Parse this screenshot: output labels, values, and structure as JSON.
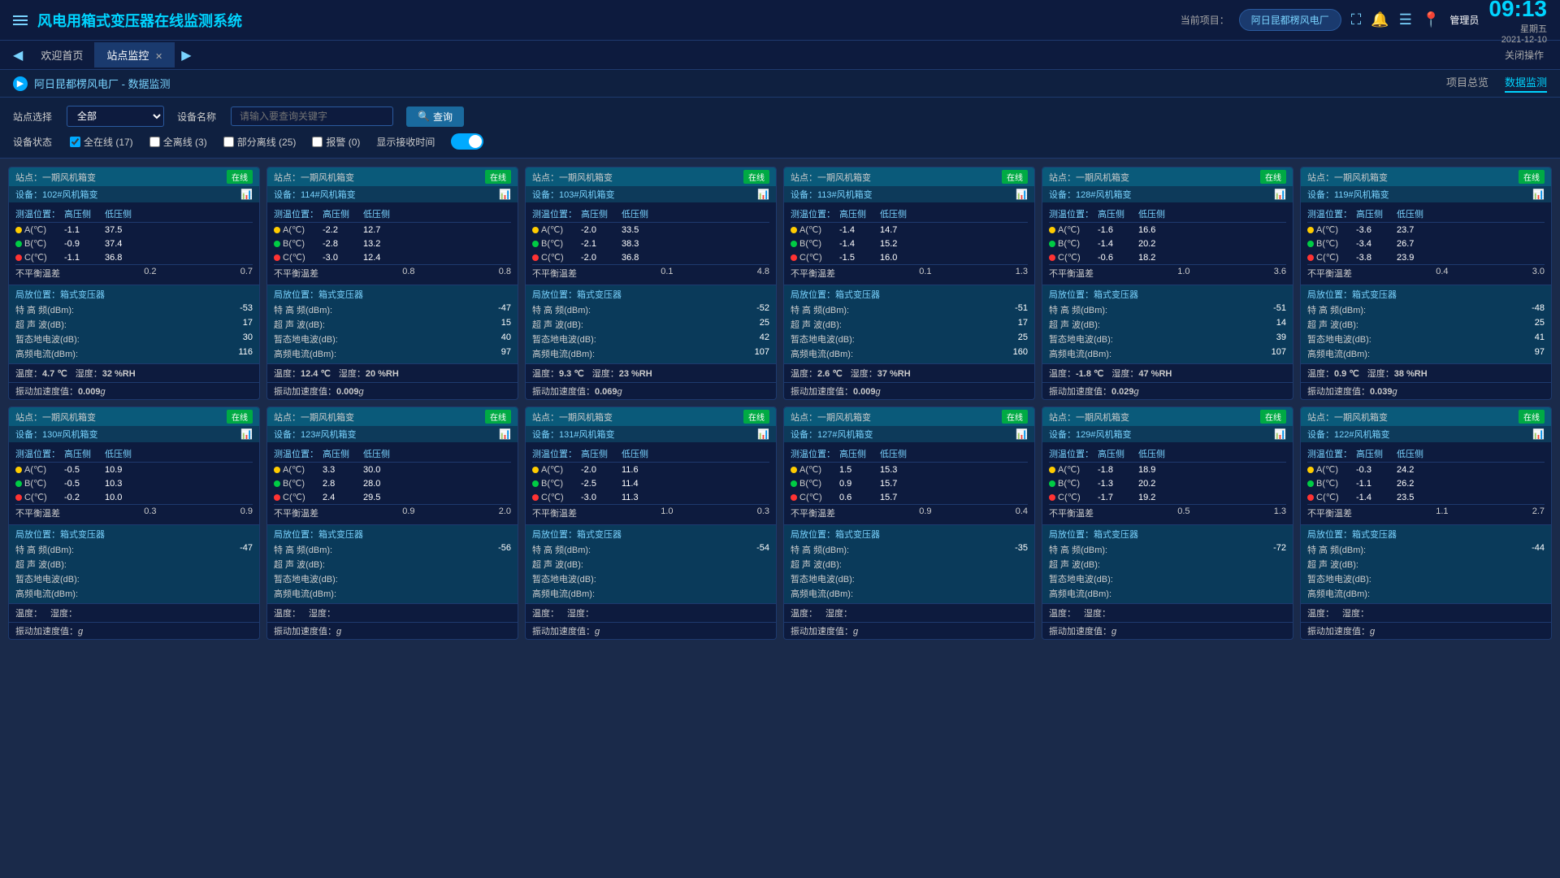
{
  "header": {
    "menu_icon": "☰",
    "title": "风电用箱式变压器在线监测系统",
    "project_label": "当前项目：",
    "project_name": "阿日昆都楞风电厂",
    "time": "09:13",
    "weekday": "星期五",
    "date": "2021-12-10",
    "user": "管理员"
  },
  "tabs": {
    "prev": "◀",
    "next": "▶",
    "items": [
      {
        "label": "欢迎首页",
        "active": false
      },
      {
        "label": "站点监控",
        "active": true,
        "closable": true
      }
    ],
    "close_op": "关闭操作"
  },
  "breadcrumb": {
    "icon": "▶",
    "path": "阿日昆都楞风电厂 - 数据监测",
    "links": [
      {
        "label": "项目总览",
        "active": false
      },
      {
        "label": "数据监测",
        "active": true
      }
    ]
  },
  "filter": {
    "station_label": "站点选择",
    "station_value": "全部",
    "device_label": "设备名称",
    "device_placeholder": "请输入要查询关键字",
    "search_label": "查询",
    "status_label": "设备状态",
    "status_options": [
      {
        "label": "全在线",
        "count": 17,
        "checked": true,
        "color": "#00aaff"
      },
      {
        "label": "全离线",
        "count": 3,
        "checked": false
      },
      {
        "label": "部分离线",
        "count": 25,
        "checked": false
      },
      {
        "label": "报警",
        "count": 0,
        "checked": false
      }
    ],
    "show_time_label": "显示接收时间",
    "toggle_on": true
  },
  "cards": [
    {
      "station": "一期风机箱变",
      "device": "102#风机箱变",
      "online": true,
      "temp_pos": {
        "high": "高压侧",
        "low": "低压侧"
      },
      "phases": [
        {
          "phase": "A(℃)",
          "dot": "yellow",
          "high": "-1.1",
          "low": "37.5"
        },
        {
          "phase": "B(℃)",
          "dot": "green",
          "high": "-0.9",
          "low": "37.4"
        },
        {
          "phase": "C(℃)",
          "dot": "red",
          "high": "-1.1",
          "low": "36.8"
        }
      ],
      "imbalance": {
        "label": "不平衡温差",
        "high": "0.2",
        "low": "0.7"
      },
      "partial_pos": "箱式变压器",
      "partial": [
        {
          "label": "特 高 频(dBm):",
          "val": "-53"
        },
        {
          "label": "超 声 波(dB):",
          "val": "17"
        },
        {
          "label": "暂态地电波(dB):",
          "val": "30"
        },
        {
          "label": "高频电流(dBm):",
          "val": "116"
        }
      ],
      "temp": "4.7 ℃",
      "humidity": "32 %RH",
      "vibration": "0.009"
    },
    {
      "station": "一期风机箱变",
      "device": "114#风机箱变",
      "online": true,
      "temp_pos": {
        "high": "高压侧",
        "low": "低压侧"
      },
      "phases": [
        {
          "phase": "A(℃)",
          "dot": "yellow",
          "high": "-2.2",
          "low": "12.7"
        },
        {
          "phase": "B(℃)",
          "dot": "green",
          "high": "-2.8",
          "low": "13.2"
        },
        {
          "phase": "C(℃)",
          "dot": "red",
          "high": "-3.0",
          "low": "12.4"
        }
      ],
      "imbalance": {
        "label": "不平衡温差",
        "high": "0.8",
        "low": "0.8"
      },
      "partial_pos": "箱式变压器",
      "partial": [
        {
          "label": "特 高 频(dBm):",
          "val": "-47"
        },
        {
          "label": "超 声 波(dB):",
          "val": "15"
        },
        {
          "label": "暂态地电波(dB):",
          "val": "40"
        },
        {
          "label": "高频电流(dBm):",
          "val": "97"
        }
      ],
      "temp": "12.4 ℃",
      "humidity": "20 %RH",
      "vibration": "0.009"
    },
    {
      "station": "一期风机箱变",
      "device": "103#风机箱变",
      "online": true,
      "temp_pos": {
        "high": "高压侧",
        "low": "低压侧"
      },
      "phases": [
        {
          "phase": "A(℃)",
          "dot": "yellow",
          "high": "-2.0",
          "low": "33.5"
        },
        {
          "phase": "B(℃)",
          "dot": "green",
          "high": "-2.1",
          "low": "38.3"
        },
        {
          "phase": "C(℃)",
          "dot": "red",
          "high": "-2.0",
          "low": "36.8"
        }
      ],
      "imbalance": {
        "label": "不平衡温差",
        "high": "0.1",
        "low": "4.8"
      },
      "partial_pos": "箱式变压器",
      "partial": [
        {
          "label": "特 高 频(dBm):",
          "val": "-52"
        },
        {
          "label": "超 声 波(dB):",
          "val": "25"
        },
        {
          "label": "暂态地电波(dB):",
          "val": "42"
        },
        {
          "label": "高频电流(dBm):",
          "val": "107"
        }
      ],
      "temp": "9.3 ℃",
      "humidity": "23 %RH",
      "vibration": "0.069"
    },
    {
      "station": "一期风机箱变",
      "device": "113#风机箱变",
      "online": true,
      "temp_pos": {
        "high": "高压侧",
        "low": "低压侧"
      },
      "phases": [
        {
          "phase": "A(℃)",
          "dot": "yellow",
          "high": "-1.4",
          "low": "14.7"
        },
        {
          "phase": "B(℃)",
          "dot": "green",
          "high": "-1.4",
          "low": "15.2"
        },
        {
          "phase": "C(℃)",
          "dot": "red",
          "high": "-1.5",
          "low": "16.0"
        }
      ],
      "imbalance": {
        "label": "不平衡温差",
        "high": "0.1",
        "low": "1.3"
      },
      "partial_pos": "箱式变压器",
      "partial": [
        {
          "label": "特 高 频(dBm):",
          "val": "-51"
        },
        {
          "label": "超 声 波(dB):",
          "val": "17"
        },
        {
          "label": "暂态地电波(dB):",
          "val": "25"
        },
        {
          "label": "高频电流(dBm):",
          "val": "160"
        }
      ],
      "temp": "2.6 ℃",
      "humidity": "37 %RH",
      "vibration": "0.009"
    },
    {
      "station": "一期风机箱变",
      "device": "128#风机箱变",
      "online": true,
      "temp_pos": {
        "high": "高压侧",
        "low": "低压侧"
      },
      "phases": [
        {
          "phase": "A(℃)",
          "dot": "yellow",
          "high": "-1.6",
          "low": "16.6"
        },
        {
          "phase": "B(℃)",
          "dot": "green",
          "high": "-1.4",
          "low": "20.2"
        },
        {
          "phase": "C(℃)",
          "dot": "red",
          "high": "-0.6",
          "low": "18.2"
        }
      ],
      "imbalance": {
        "label": "不平衡温差",
        "high": "1.0",
        "low": "3.6"
      },
      "partial_pos": "箱式变压器",
      "partial": [
        {
          "label": "特 高 频(dBm):",
          "val": "-51"
        },
        {
          "label": "超 声 波(dB):",
          "val": "14"
        },
        {
          "label": "暂态地电波(dB):",
          "val": "39"
        },
        {
          "label": "高频电流(dBm):",
          "val": "107"
        }
      ],
      "temp": "-1.8 ℃",
      "humidity": "47 %RH",
      "vibration": "0.029"
    },
    {
      "station": "一期风机箱变",
      "device": "119#风机箱变",
      "online": true,
      "temp_pos": {
        "high": "高压侧",
        "low": "低压侧"
      },
      "phases": [
        {
          "phase": "A(℃)",
          "dot": "yellow",
          "high": "-3.6",
          "low": "23.7"
        },
        {
          "phase": "B(℃)",
          "dot": "green",
          "high": "-3.4",
          "low": "26.7"
        },
        {
          "phase": "C(℃)",
          "dot": "red",
          "high": "-3.8",
          "low": "23.9"
        }
      ],
      "imbalance": {
        "label": "不平衡温差",
        "high": "0.4",
        "low": "3.0"
      },
      "partial_pos": "箱式变压器",
      "partial": [
        {
          "label": "特 高 频(dBm):",
          "val": "-48"
        },
        {
          "label": "超 声 波(dB):",
          "val": "25"
        },
        {
          "label": "暂态地电波(dB):",
          "val": "41"
        },
        {
          "label": "高频电流(dBm):",
          "val": "97"
        }
      ],
      "temp": "0.9 ℃",
      "humidity": "38 %RH",
      "vibration": "0.039"
    },
    {
      "station": "一期风机箱变",
      "device": "130#风机箱变",
      "online": true,
      "temp_pos": {
        "high": "高压侧",
        "low": "低压侧"
      },
      "phases": [
        {
          "phase": "A(℃)",
          "dot": "yellow",
          "high": "-0.5",
          "low": "10.9"
        },
        {
          "phase": "B(℃)",
          "dot": "green",
          "high": "-0.5",
          "low": "10.3"
        },
        {
          "phase": "C(℃)",
          "dot": "red",
          "high": "-0.2",
          "low": "10.0"
        }
      ],
      "imbalance": {
        "label": "不平衡温差",
        "high": "0.3",
        "low": "0.9"
      },
      "partial_pos": "箱式变压器",
      "partial": [
        {
          "label": "特 高 频(dBm):",
          "val": "-47"
        },
        {
          "label": "超 声 波(dB):",
          "val": ""
        },
        {
          "label": "暂态地电波(dB):",
          "val": ""
        },
        {
          "label": "高频电流(dBm):",
          "val": ""
        }
      ],
      "temp": "",
      "humidity": "",
      "vibration": ""
    },
    {
      "station": "一期风机箱变",
      "device": "123#风机箱变",
      "online": true,
      "temp_pos": {
        "high": "高压侧",
        "low": "低压侧"
      },
      "phases": [
        {
          "phase": "A(℃)",
          "dot": "yellow",
          "high": "3.3",
          "low": "30.0"
        },
        {
          "phase": "B(℃)",
          "dot": "green",
          "high": "2.8",
          "low": "28.0"
        },
        {
          "phase": "C(℃)",
          "dot": "red",
          "high": "2.4",
          "low": "29.5"
        }
      ],
      "imbalance": {
        "label": "不平衡温差",
        "high": "0.9",
        "low": "2.0"
      },
      "partial_pos": "箱式变压器",
      "partial": [
        {
          "label": "特 高 频(dBm):",
          "val": "-56"
        },
        {
          "label": "超 声 波(dB):",
          "val": ""
        },
        {
          "label": "暂态地电波(dB):",
          "val": ""
        },
        {
          "label": "高频电流(dBm):",
          "val": ""
        }
      ],
      "temp": "",
      "humidity": "",
      "vibration": ""
    },
    {
      "station": "一期风机箱变",
      "device": "131#风机箱变",
      "online": true,
      "temp_pos": {
        "high": "高压侧",
        "low": "低压侧"
      },
      "phases": [
        {
          "phase": "A(℃)",
          "dot": "yellow",
          "high": "-2.0",
          "low": "11.6"
        },
        {
          "phase": "B(℃)",
          "dot": "green",
          "high": "-2.5",
          "low": "11.4"
        },
        {
          "phase": "C(℃)",
          "dot": "red",
          "high": "-3.0",
          "low": "11.3"
        }
      ],
      "imbalance": {
        "label": "不平衡温差",
        "high": "1.0",
        "low": "0.3"
      },
      "partial_pos": "箱式变压器",
      "partial": [
        {
          "label": "特 高 频(dBm):",
          "val": "-54"
        },
        {
          "label": "超 声 波(dB):",
          "val": ""
        },
        {
          "label": "暂态地电波(dB):",
          "val": ""
        },
        {
          "label": "高频电流(dBm):",
          "val": ""
        }
      ],
      "temp": "",
      "humidity": "",
      "vibration": ""
    },
    {
      "station": "一期风机箱变",
      "device": "127#风机箱变",
      "online": true,
      "temp_pos": {
        "high": "高压侧",
        "low": "低压侧"
      },
      "phases": [
        {
          "phase": "A(℃)",
          "dot": "yellow",
          "high": "1.5",
          "low": "15.3"
        },
        {
          "phase": "B(℃)",
          "dot": "green",
          "high": "0.9",
          "low": "15.7"
        },
        {
          "phase": "C(℃)",
          "dot": "red",
          "high": "0.6",
          "low": "15.7"
        }
      ],
      "imbalance": {
        "label": "不平衡温差",
        "high": "0.9",
        "low": "0.4"
      },
      "partial_pos": "箱式变压器",
      "partial": [
        {
          "label": "特 高 频(dBm):",
          "val": "-35"
        },
        {
          "label": "超 声 波(dB):",
          "val": ""
        },
        {
          "label": "暂态地电波(dB):",
          "val": ""
        },
        {
          "label": "高频电流(dBm):",
          "val": ""
        }
      ],
      "temp": "",
      "humidity": "",
      "vibration": ""
    },
    {
      "station": "一期风机箱变",
      "device": "129#风机箱变",
      "online": true,
      "temp_pos": {
        "high": "高压侧",
        "low": "低压侧"
      },
      "phases": [
        {
          "phase": "A(℃)",
          "dot": "yellow",
          "high": "-1.8",
          "low": "18.9"
        },
        {
          "phase": "B(℃)",
          "dot": "green",
          "high": "-1.3",
          "low": "20.2"
        },
        {
          "phase": "C(℃)",
          "dot": "red",
          "high": "-1.7",
          "low": "19.2"
        }
      ],
      "imbalance": {
        "label": "不平衡温差",
        "high": "0.5",
        "low": "1.3"
      },
      "partial_pos": "箱式变压器",
      "partial": [
        {
          "label": "特 高 频(dBm):",
          "val": "-72"
        },
        {
          "label": "超 声 波(dB):",
          "val": ""
        },
        {
          "label": "暂态地电波(dB):",
          "val": ""
        },
        {
          "label": "高频电流(dBm):",
          "val": ""
        }
      ],
      "temp": "",
      "humidity": "",
      "vibration": ""
    },
    {
      "station": "一期风机箱变",
      "device": "122#风机箱变",
      "online": true,
      "temp_pos": {
        "high": "高压侧",
        "low": "低压侧"
      },
      "phases": [
        {
          "phase": "A(℃)",
          "dot": "yellow",
          "high": "-0.3",
          "low": "24.2"
        },
        {
          "phase": "B(℃)",
          "dot": "green",
          "high": "-1.1",
          "low": "26.2"
        },
        {
          "phase": "C(℃)",
          "dot": "red",
          "high": "-1.4",
          "low": "23.5"
        }
      ],
      "imbalance": {
        "label": "不平衡温差",
        "high": "1.1",
        "low": "2.7"
      },
      "partial_pos": "箱式变压器",
      "partial": [
        {
          "label": "特 高 频(dBm):",
          "val": "-44"
        },
        {
          "label": "超 声 波(dB):",
          "val": ""
        },
        {
          "label": "暂态地电波(dB):",
          "val": ""
        },
        {
          "label": "高频电流(dBm):",
          "val": ""
        }
      ],
      "temp": "",
      "humidity": "",
      "vibration": ""
    }
  ],
  "labels": {
    "station_prefix": "站点：",
    "device_prefix": "设备：",
    "measure_pos": "测温位置：",
    "high_side": "高压侧",
    "low_side": "低压侧",
    "partial_pos_label": "局放位置：",
    "temp_label": "温度：",
    "humidity_label": "湿度：",
    "vibration_label": "振动加速度值：",
    "g_unit": "g"
  }
}
